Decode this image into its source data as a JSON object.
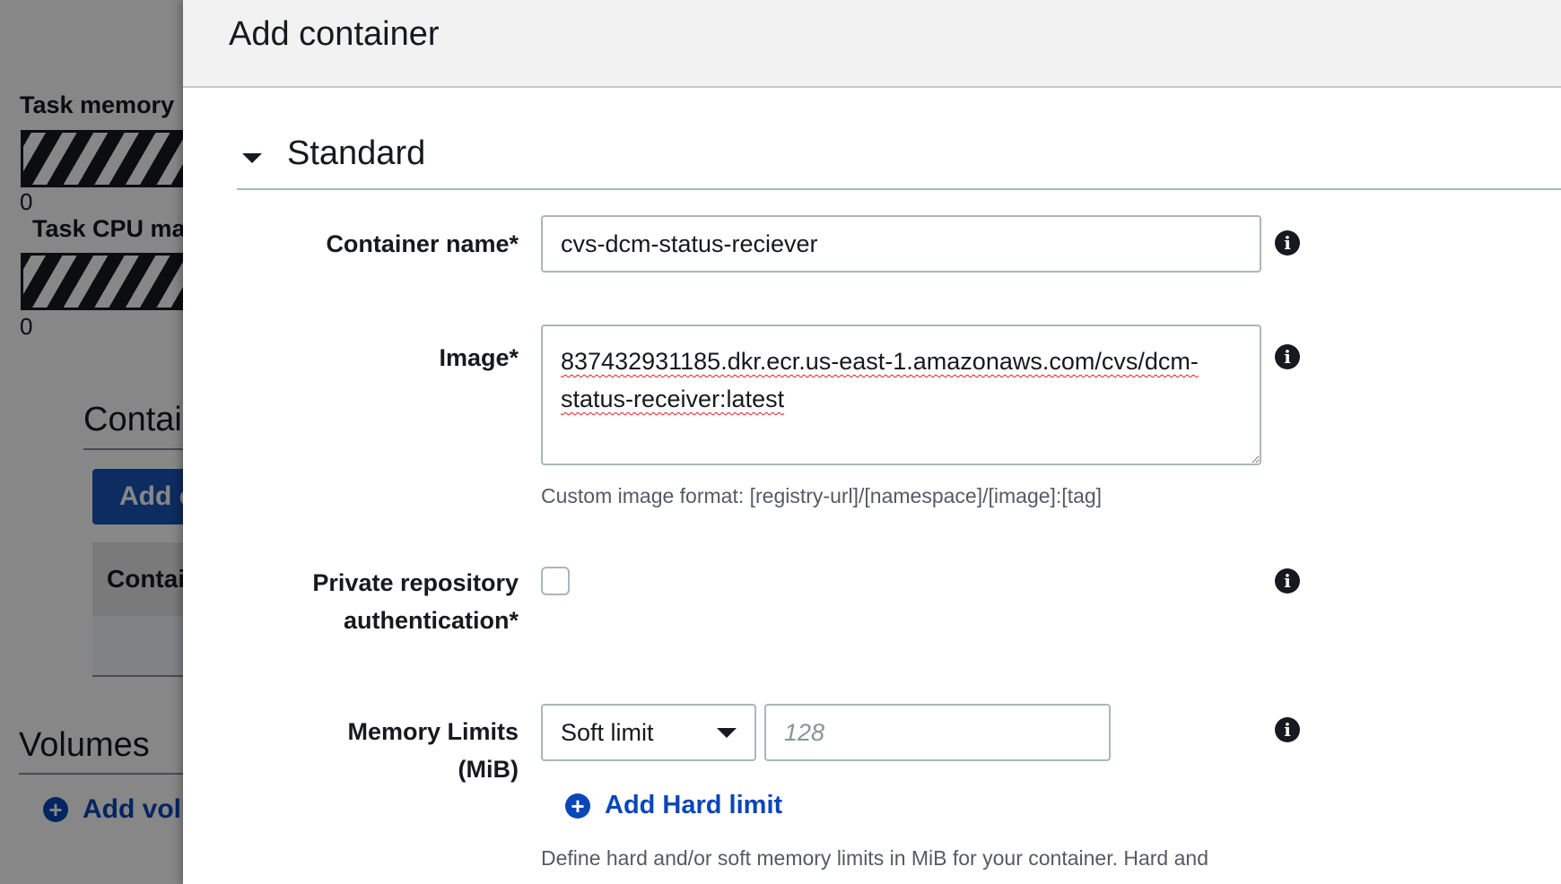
{
  "background": {
    "task_memory_label": "Task memory",
    "task_cpu_label": "Task CPU ma",
    "memory_zero": "0",
    "cpu_zero": "0",
    "containers_heading": "Contai",
    "add_container_button": "Add c",
    "table_header": "Contai",
    "volumes_heading": "Volumes",
    "add_volume_link": "Add volu"
  },
  "modal": {
    "title": "Add container",
    "section_title": "Standard",
    "fields": {
      "container_name": {
        "label": "Container name*",
        "value": "cvs-dcm-status-reciever"
      },
      "image": {
        "label": "Image*",
        "value": "837432931185.dkr.ecr.us-east-1.amazonaws.com/cvs/dcm-status-receiver:latest",
        "help": "Custom image format: [registry-url]/[namespace]/[image]:[tag]"
      },
      "private_repo_auth": {
        "label_line1": "Private repository",
        "label_line2": "authentication*",
        "checked": false
      },
      "memory_limits": {
        "label_line1": "Memory Limits",
        "label_line2": "(MiB)",
        "select_value": "Soft limit",
        "placeholder": "128",
        "add_hard_limit": "Add Hard limit",
        "help": "Define hard and/or soft memory limits in MiB for your container. Hard and"
      }
    }
  },
  "icons": {
    "info": "info-icon",
    "plus": "plus-circle-icon",
    "caret": "caret-down-icon"
  },
  "colors": {
    "link_blue": "#0b46b8",
    "primary_button": "#1a53b5",
    "text": "#16191f",
    "border": "#aab7b8",
    "help_text": "#545b64"
  }
}
